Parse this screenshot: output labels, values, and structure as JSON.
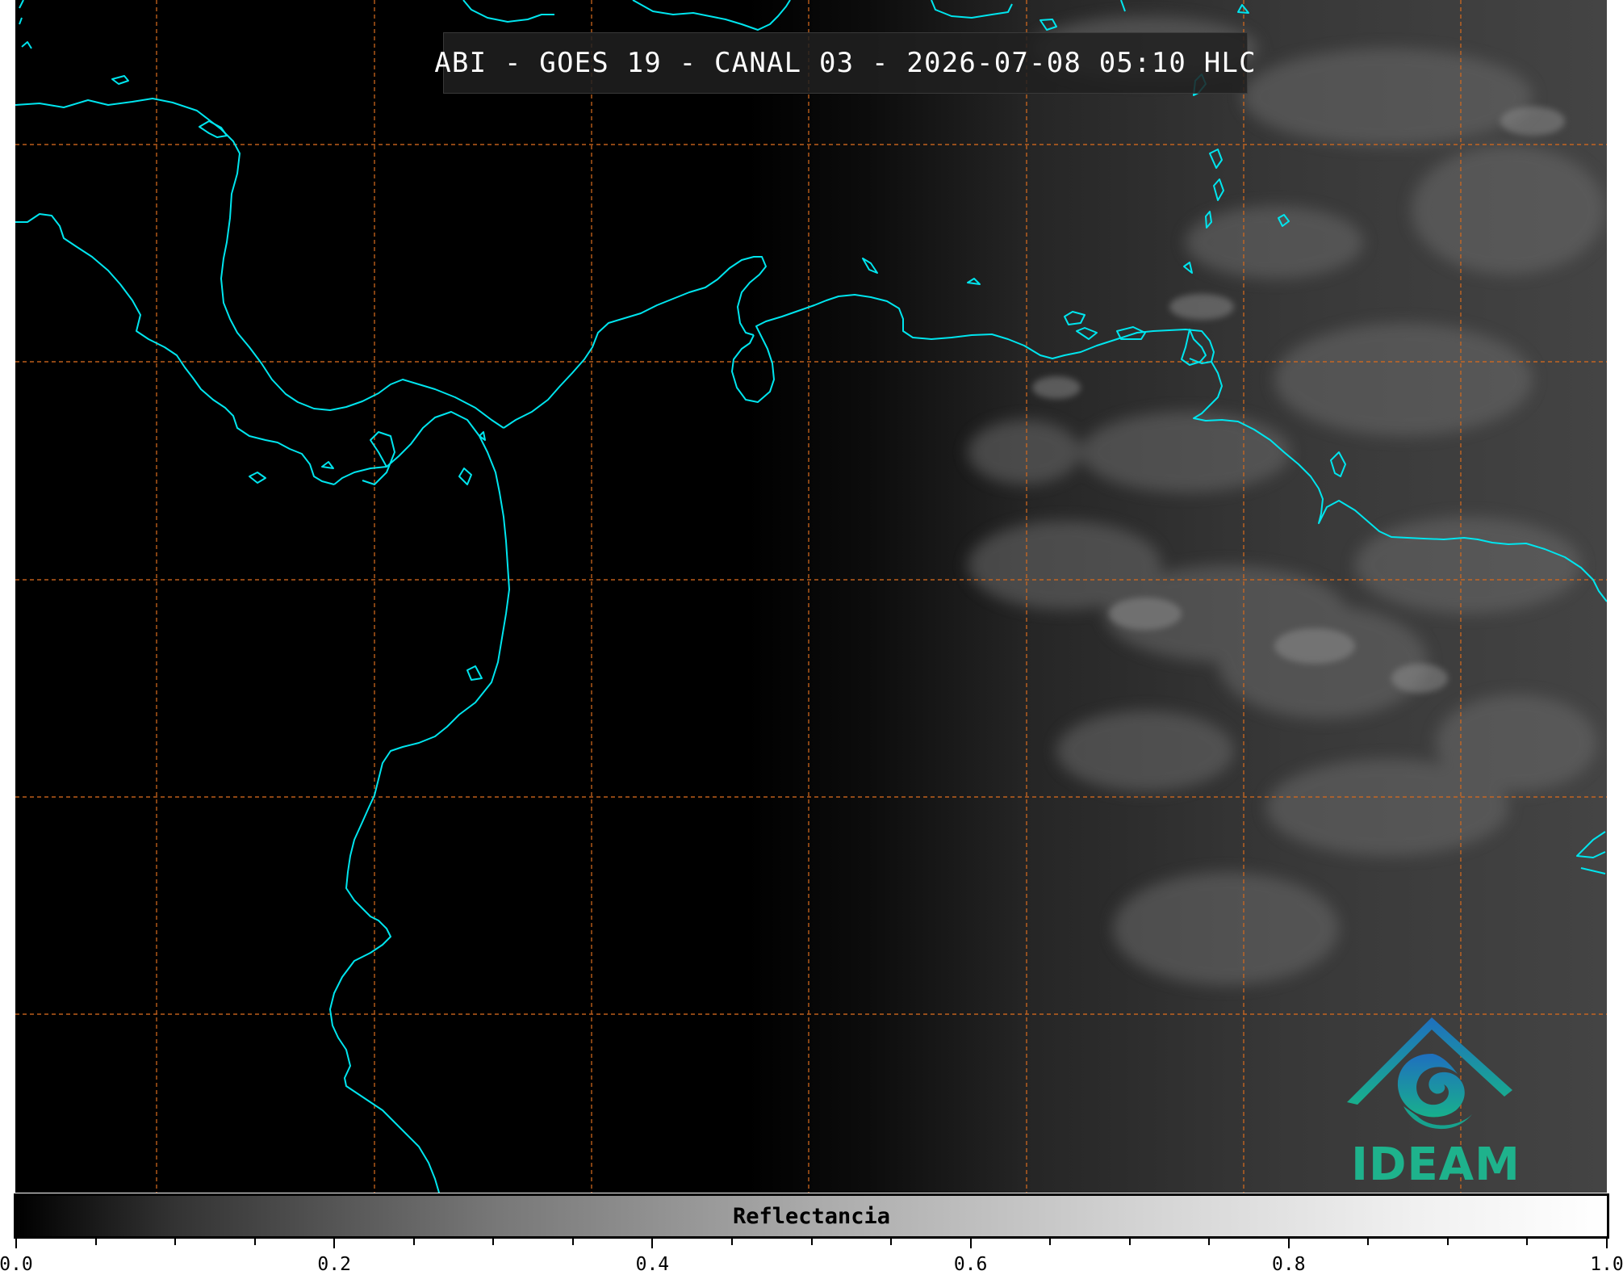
{
  "map": {
    "title": "ABI - GOES 19 - CANAL 03 - 2026-07-08 05:10 HLC",
    "coastline_color": "#00e5ee",
    "gridline_color": "#d2691e",
    "background_color": "#000000"
  },
  "logo": {
    "text": "IDEAM",
    "colors": {
      "mountain": "#1f7fbf",
      "swirl": "#17a2a0",
      "text": "#1eb28c"
    }
  },
  "colorbar": {
    "label": "Reflectancia",
    "range": [
      0.0,
      1.0
    ],
    "colormap": "grayscale",
    "tick_labels": [
      "0.0",
      "0.2",
      "0.4",
      "0.6",
      "0.8",
      "1.0"
    ]
  }
}
